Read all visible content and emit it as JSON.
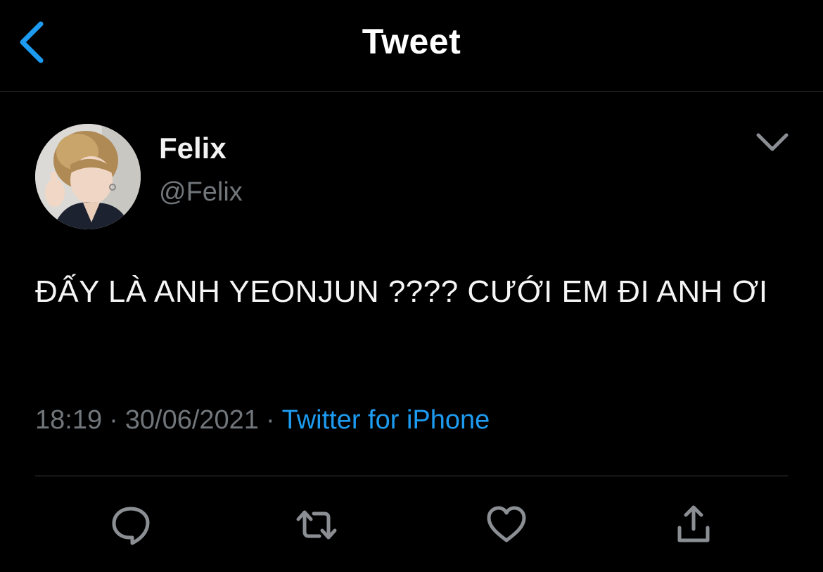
{
  "header": {
    "title": "Tweet",
    "back_icon": "chevron-left-icon",
    "accent_color": "#1d9bf0"
  },
  "tweet": {
    "author": {
      "display_name": "Felix",
      "handle": "@Felix",
      "avatar_icon": "user-avatar"
    },
    "more_icon": "chevron-down-icon",
    "text": "ĐẤY LÀ ANH YEONJUN ???? CƯỚI EM ĐI ANH ƠI",
    "time": "18:19",
    "separator": "·",
    "date": "30/06/2021",
    "source": "Twitter for iPhone"
  },
  "actions": [
    {
      "name": "reply",
      "icon": "reply-icon"
    },
    {
      "name": "retweet",
      "icon": "retweet-icon"
    },
    {
      "name": "like",
      "icon": "heart-icon"
    },
    {
      "name": "share",
      "icon": "share-icon"
    }
  ],
  "colors": {
    "background": "#000000",
    "text_primary": "#ffffff",
    "text_secondary": "#71767b",
    "link": "#1d9bf0",
    "divider": "#2f3336"
  }
}
